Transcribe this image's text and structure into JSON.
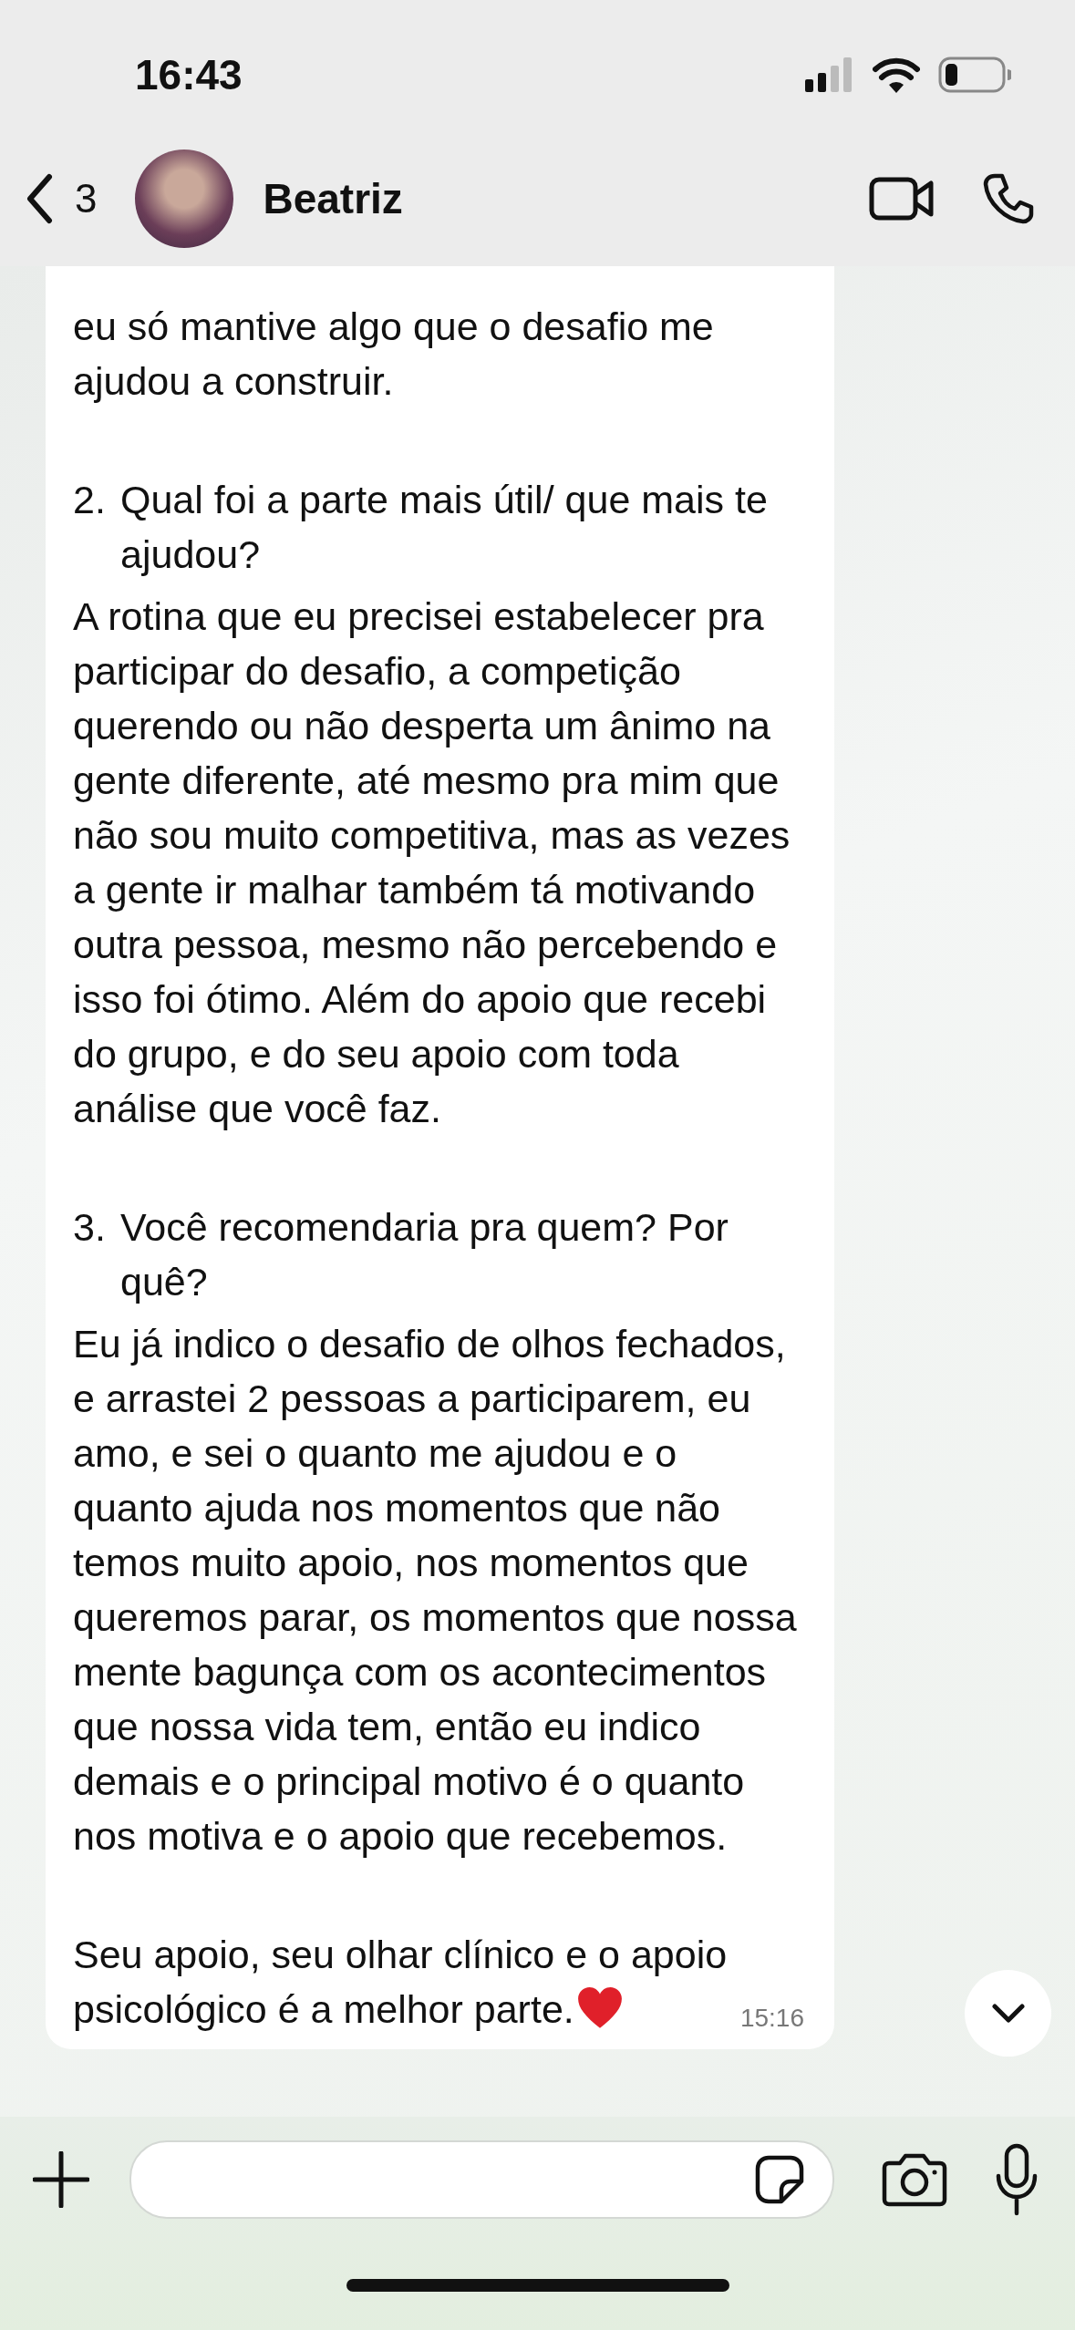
{
  "status_bar": {
    "time": "16:43"
  },
  "header": {
    "back_count": "3",
    "contact_name": "Beatriz"
  },
  "message": {
    "paragraphs": [
      {
        "kind": "text",
        "text": "eu só mantive algo que o desafio me ajudou a construir."
      },
      {
        "kind": "numbered",
        "number": "2.",
        "text": "Qual foi a parte mais útil/ que mais te ajudou?"
      },
      {
        "kind": "text",
        "text": "A rotina que eu precisei estabelecer pra participar do desafio, a competição querendo ou não desperta um ânimo na gente diferente, até mesmo pra mim que não sou muito competitiva, mas as vezes a gente ir malhar também tá motivando outra pessoa, mesmo não percebendo e isso foi ótimo. Além do apoio que recebi do grupo, e do seu apoio com toda análise que você faz."
      },
      {
        "kind": "numbered",
        "number": "3.",
        "text": "Você recomendaria pra quem? Por quê?"
      },
      {
        "kind": "text",
        "text": "Eu já indico o desafio de olhos fechados, e arrastei 2 pessoas a participarem, eu amo, e sei o quanto me ajudou e o quanto ajuda nos momentos que não temos muito apoio, nos momentos que queremos parar, os momentos que nossa mente bagunça com os acontecimentos que nossa vida tem, então eu indico demais e o principal motivo é o quanto nos motiva e o apoio que recebemos."
      },
      {
        "kind": "closing",
        "text": "Seu apoio, seu olhar clínico e o apoio psicológico é a melhor parte."
      }
    ],
    "time": "15:16"
  }
}
